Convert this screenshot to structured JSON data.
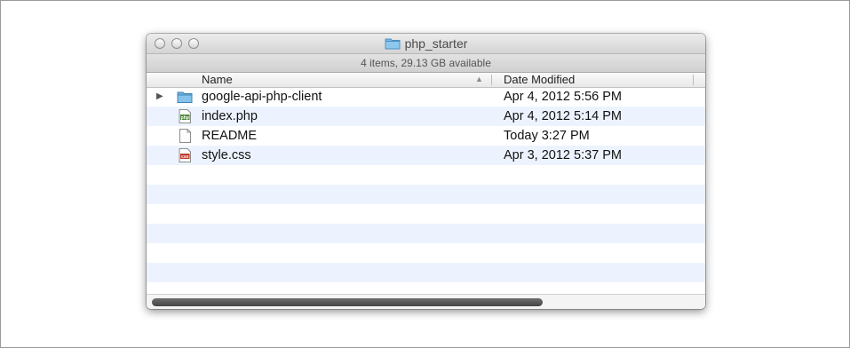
{
  "window": {
    "title": "php_starter",
    "status": "4 items, 29.13 GB available"
  },
  "columns": {
    "name": "Name",
    "date_modified": "Date Modified"
  },
  "files": [
    {
      "name": "google-api-php-client",
      "date": "Apr 4, 2012 5:56 PM",
      "icon": "folder-icon"
    },
    {
      "name": "index.php",
      "date": "Apr 4, 2012 5:14 PM",
      "icon": "php-file-icon"
    },
    {
      "name": "README",
      "date": "Today 3:27 PM",
      "icon": "document-icon"
    },
    {
      "name": "style.css",
      "date": "Apr 3, 2012 5:37 PM",
      "icon": "css-file-icon"
    }
  ],
  "colors": {
    "row_alt": "#edf3fe",
    "folder": "#6fb3e0"
  }
}
